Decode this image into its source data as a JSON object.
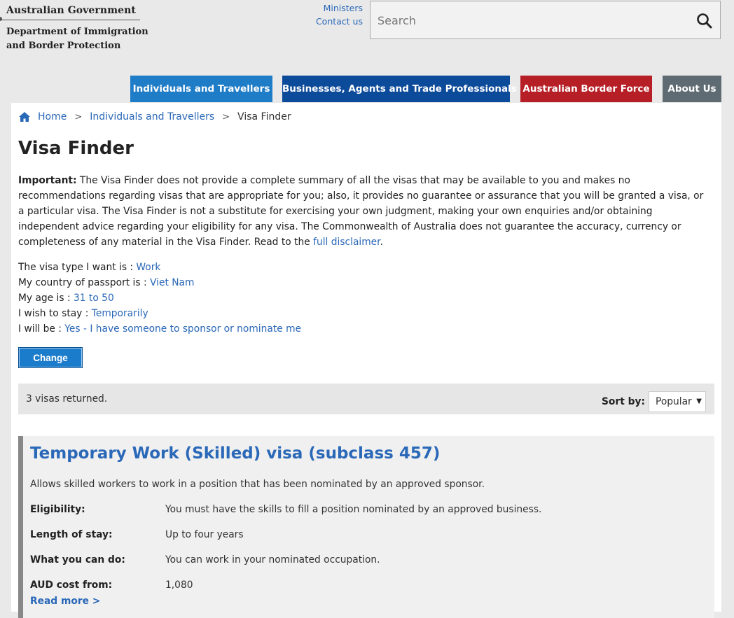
{
  "header": {
    "gov_line1": "Australian Government",
    "gov_line2": "Department of Immigration",
    "gov_line3": "and Border Protection",
    "links": [
      "Ministers",
      "Contact us"
    ],
    "search_placeholder": "Search"
  },
  "nav": {
    "items": [
      {
        "label": "Individuals and Travellers",
        "color": "#1f7cc7"
      },
      {
        "label": "Businesses, Agents and Trade Professionals",
        "color": "#0c4a9a"
      },
      {
        "label": "Australian Border Force",
        "color": "#b71f27"
      },
      {
        "label": "About Us",
        "color": "#5f6b73"
      }
    ]
  },
  "breadcrumb": {
    "home": "Home",
    "sep": ">",
    "level1": "Individuals and Travellers",
    "current": "Visa Finder"
  },
  "page": {
    "title": "Visa Finder",
    "important_label": "Important:",
    "disclaimer_text": " The Visa Finder does not provide a complete summary of all the visas that may be available to you and makes no recommendations regarding visas that are appropriate for you; also, it provides no guarantee or assurance that you will be granted a visa, or a particular visa. The Visa Finder is not a substitute for exercising your own judgment, making your own enquiries and/or obtaining independent advice regarding your eligibility for any visa. The Commonwealth of Australia does not guarantee the accuracy, currency or completeness of any material in the Visa Finder. Read to the ",
    "disclaimer_link": "full disclaimer",
    "disclaimer_end": "."
  },
  "criteria": [
    {
      "label": "The visa type I want is : ",
      "value": "Work"
    },
    {
      "label": "My country of passport is : ",
      "value": "Viet Nam"
    },
    {
      "label": "My age is : ",
      "value": "31 to 50"
    },
    {
      "label": "I wish to stay : ",
      "value": "Temporarily"
    },
    {
      "label": "I will be : ",
      "value": "Yes - I have someone to sponsor or nominate me"
    }
  ],
  "change_button": "Change",
  "results": {
    "count_text": "3 visas returned.",
    "sort_label": "Sort by:",
    "sort_value": "Popular"
  },
  "visa": {
    "title": "Temporary Work (Skilled) visa (subclass 457)",
    "description": "Allows skilled workers to work in a position that has been nominated by an approved sponsor.",
    "rows": [
      {
        "key": "Eligibility:",
        "value": "You must have the skills to fill a position nominated by an approved business."
      },
      {
        "key": "Length of stay:",
        "value": "Up to four years"
      },
      {
        "key": "What you can do:",
        "value": "You can work in your nominated occupation."
      },
      {
        "key": "AUD cost from:",
        "value": "1,080"
      }
    ],
    "read_more": "Read more >"
  }
}
